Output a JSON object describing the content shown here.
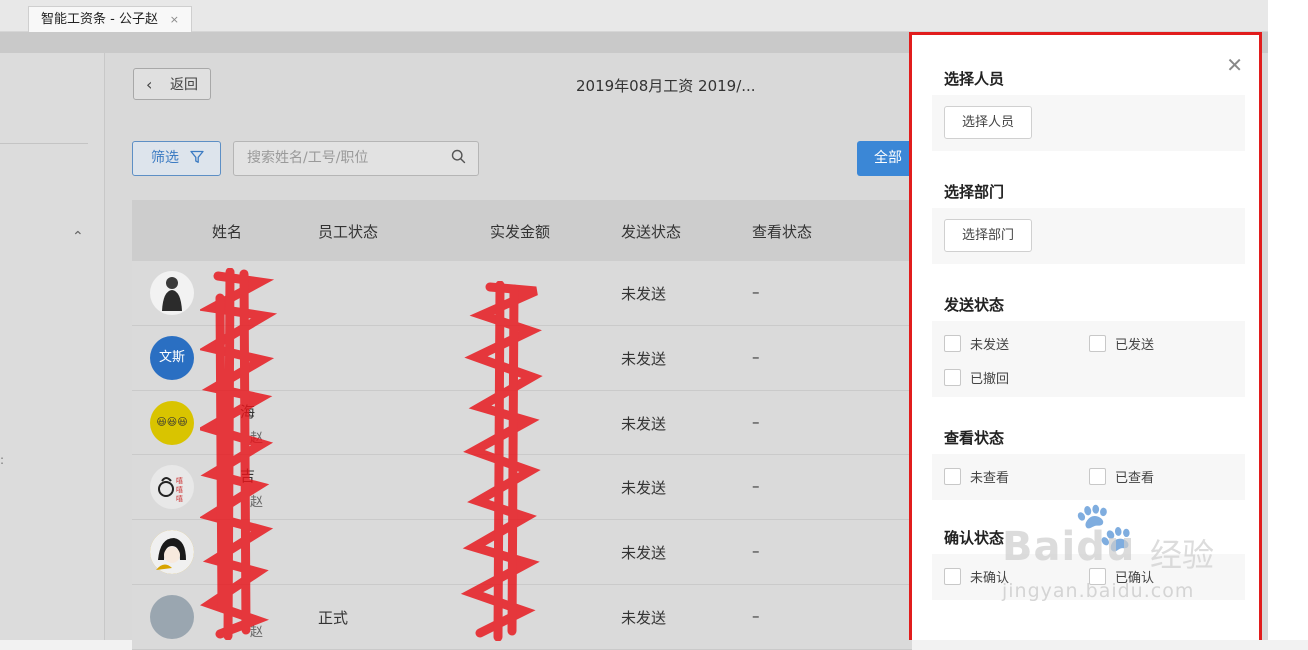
{
  "tab": {
    "title": "智能工资条 - 公子赵",
    "close": "×"
  },
  "toolbar": {
    "back_icon": "‹",
    "back_label": "返回",
    "page_title": "2019年08月工资 2019/...",
    "filter_label": "筛选",
    "search_placeholder": "搜索姓名/工号/职位",
    "all_button_label": "全部"
  },
  "table": {
    "headers": [
      "姓名",
      "员工状态",
      "实发金额",
      "发送状态",
      "查看状态"
    ],
    "rows": [
      {
        "avatar": "",
        "avatar_color": "#555555",
        "status": "",
        "send": "未发送",
        "view": "–"
      },
      {
        "avatar": "文斯",
        "avatar_color": "#2a6fc2",
        "status": "",
        "send": "未发送",
        "view": "–"
      },
      {
        "avatar": "😃😃😃",
        "avatar_color": "#d9c400",
        "status": "",
        "send": "未发送",
        "view": "–",
        "name_fragment": "海",
        "sub_fragment": "赵"
      },
      {
        "avatar": "",
        "avatar_color": "#e8e8e8",
        "status": "",
        "send": "未发送",
        "view": "–",
        "name_fragment": "吉",
        "sub_fragment": "赵"
      },
      {
        "avatar": "",
        "avatar_color": "#d8a400",
        "status": "",
        "send": "未发送",
        "view": "–"
      },
      {
        "avatar": "",
        "avatar_color": "#9aa6b0",
        "status": "正式",
        "send": "未发送",
        "view": "–",
        "sub_fragment": "赵"
      }
    ]
  },
  "drawer": {
    "close": "✕",
    "sections": {
      "person": {
        "title": "选择人员",
        "button": "选择人员"
      },
      "department": {
        "title": "选择部门",
        "button": "选择部门"
      },
      "send_status": {
        "title": "发送状态",
        "options": [
          "未发送",
          "已发送",
          "已撤回"
        ]
      },
      "view_status": {
        "title": "查看状态",
        "options": [
          "未查看",
          "已查看"
        ]
      },
      "confirm_status": {
        "title": "确认状态",
        "options": [
          "未确认",
          "已确认"
        ]
      }
    }
  },
  "watermark": {
    "brand": "Baidu",
    "jingyan": "经验",
    "url": "jingyan.baidu.com"
  },
  "colors": {
    "accent": "#3b87d6",
    "highlight_border": "#e11c1c",
    "redact": "#e8141a"
  }
}
